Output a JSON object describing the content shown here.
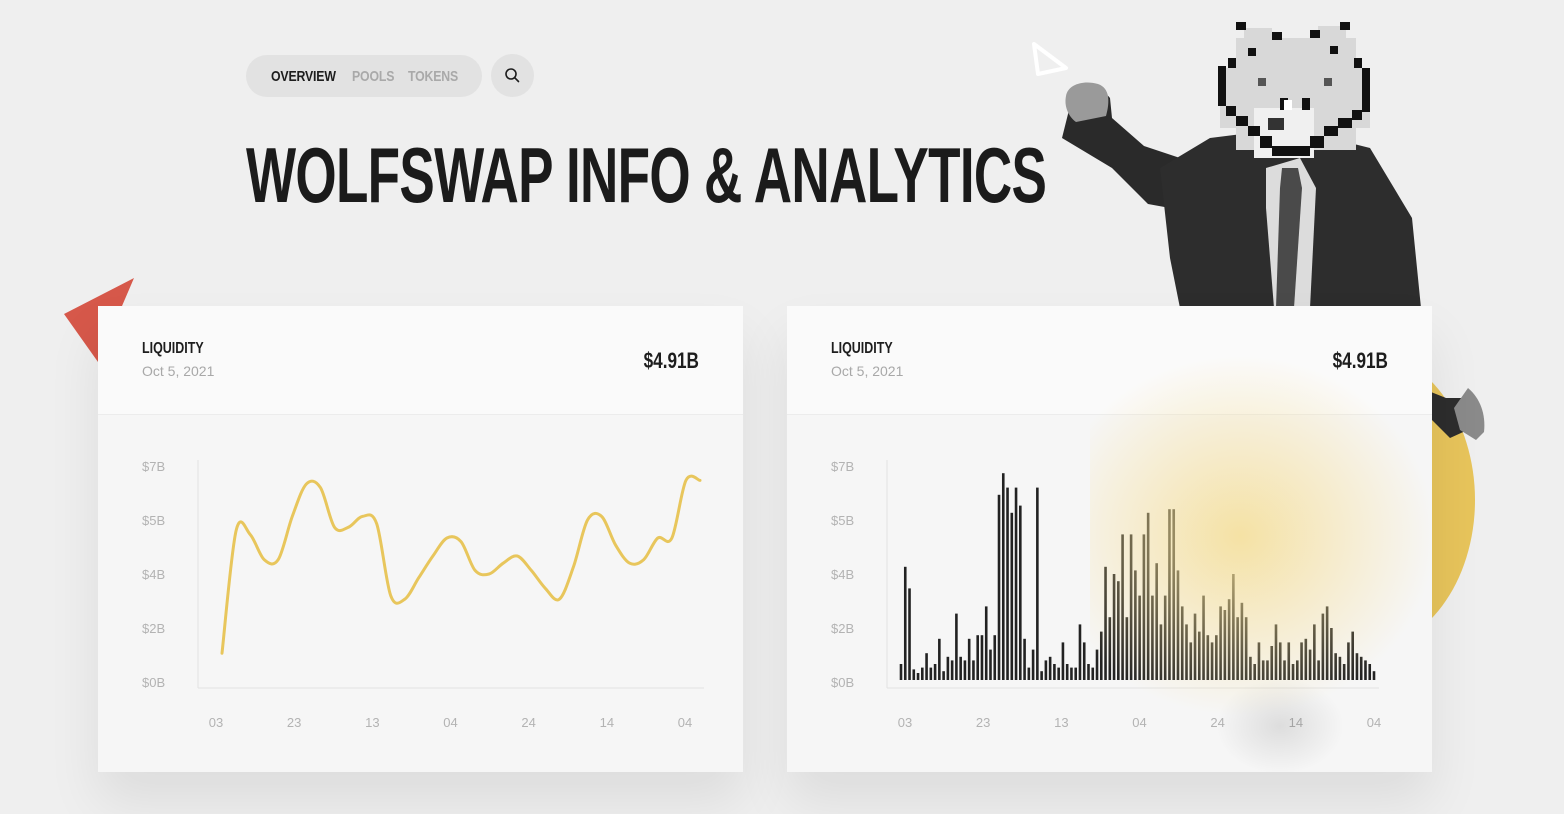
{
  "nav": {
    "items": [
      {
        "label": "OVERVIEW",
        "active": true
      },
      {
        "label": "POOLS",
        "active": false
      },
      {
        "label": "TOKENS",
        "active": false
      }
    ],
    "search_icon": "search-icon"
  },
  "page": {
    "title": "WOLFSWAP INFO & ANALYTICS"
  },
  "colors": {
    "accent_yellow": "#e8c65c",
    "accent_red": "#d6584a",
    "bar": "#222222"
  },
  "cards": [
    {
      "label": "LIQUIDITY",
      "date": "Oct 5, 2021",
      "value": "$4.91B"
    },
    {
      "label": "LIQUIDITY",
      "date": "Oct 5, 2021",
      "value": "$4.91B"
    }
  ],
  "chart_data": [
    {
      "type": "line",
      "y_tick_labels": [
        "$7B",
        "$5B",
        "$4B",
        "$2B",
        "$0B"
      ],
      "x_tick_labels": [
        "03",
        "23",
        "13",
        "04",
        "24",
        "14",
        "04"
      ],
      "series": [
        {
          "values": [
            1.8,
            5.2,
            5.1,
            4.4,
            4.4,
            5.6,
            6.5,
            6.4,
            5.3,
            5.3,
            5.6,
            5.4,
            3.4,
            3.3,
            3.9,
            4.5,
            5.0,
            4.9,
            4.1,
            4.0,
            4.3,
            4.5,
            4.1,
            3.6,
            3.3,
            4.2,
            5.5,
            5.6,
            4.8,
            4.3,
            4.4,
            5.0,
            5.0,
            6.6,
            6.6
          ]
        }
      ],
      "color": "#e8c65c",
      "grid": false
    },
    {
      "type": "bar",
      "y_tick_labels": [
        "$7B",
        "$5B",
        "$4B",
        "$2B",
        "$0B"
      ],
      "x_tick_labels": [
        "03",
        "23",
        "13",
        "04",
        "24",
        "14",
        "04"
      ],
      "values": [
        0.5,
        3.2,
        2.6,
        0.35,
        0.25,
        0.4,
        0.8,
        0.4,
        0.5,
        1.2,
        0.3,
        0.7,
        0.6,
        1.9,
        0.7,
        0.6,
        1.2,
        0.6,
        1.3,
        1.3,
        2.1,
        0.9,
        1.3,
        5.2,
        5.8,
        5.4,
        4.7,
        5.4,
        4.9,
        1.2,
        0.4,
        0.9,
        5.4,
        0.3,
        0.6,
        0.7,
        0.5,
        0.4,
        1.1,
        0.5,
        0.4,
        0.4,
        1.6,
        1.1,
        0.5,
        0.4,
        0.9,
        1.4,
        3.2,
        1.8,
        3.0,
        2.8,
        4.1,
        1.8,
        4.1,
        3.1,
        2.4,
        4.1,
        4.7,
        2.4,
        3.3,
        1.6,
        2.4,
        4.8,
        4.8,
        3.1,
        2.1,
        1.6,
        1.1,
        1.9,
        1.4,
        2.4,
        1.3,
        1.1,
        1.3,
        2.1,
        2.0,
        2.3,
        3.0,
        1.8,
        2.2,
        1.8,
        0.7,
        0.5,
        1.1,
        0.6,
        0.6,
        1.0,
        1.6,
        1.1,
        0.6,
        1.1,
        0.5,
        0.6,
        1.1,
        1.2,
        0.9,
        1.6,
        0.6,
        1.9,
        2.1,
        1.5,
        0.8,
        0.7,
        0.5,
        1.1,
        1.4,
        0.8,
        0.7,
        0.6,
        0.5,
        0.3
      ],
      "color": "#222222",
      "grid": false
    }
  ]
}
